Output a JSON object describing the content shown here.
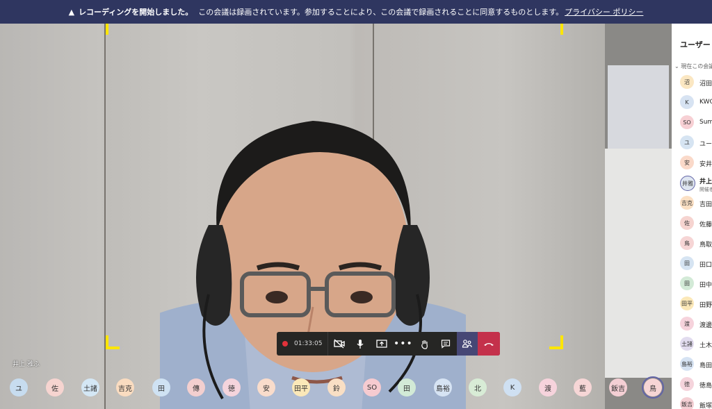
{
  "banner": {
    "warning_icon": "▲",
    "recording_started": "レコーディングを開始しました。",
    "message": "この会議は録画されています。参加することにより、この会議で録画されることに同意するものとします。",
    "privacy_link": "プライバシー ポリシー"
  },
  "video": {
    "user_label": "井上 雅ふ"
  },
  "controls": {
    "recording_time": "01:33:05",
    "icons": [
      "camera-off-icon",
      "microphone-icon",
      "share-screen-icon",
      "more-options-icon",
      "raise-hand-icon",
      "chat-icon",
      "participants-icon",
      "hang-up-icon"
    ]
  },
  "avatar_row": [
    {
      "initials": "ユ",
      "color": "#c7dcef"
    },
    {
      "initials": "佐",
      "color": "#f6d4d0"
    },
    {
      "initials": "土諸",
      "color": "#d4e7f5"
    },
    {
      "initials": "吉克",
      "color": "#fadcc0"
    },
    {
      "initials": "田",
      "color": "#cfe2f3"
    },
    {
      "initials": "傳",
      "color": "#f3cfcf"
    },
    {
      "initials": "徳",
      "color": "#f5d4dc"
    },
    {
      "initials": "安",
      "color": "#f9dccb"
    },
    {
      "initials": "田平",
      "color": "#fbe8b8"
    },
    {
      "initials": "鈴",
      "color": "#f9dfc4"
    },
    {
      "initials": "SO",
      "color": "#f6cbd0"
    },
    {
      "initials": "田",
      "color": "#d2ead6"
    },
    {
      "initials": "島裕",
      "color": "#d6e3f3"
    },
    {
      "initials": "北",
      "color": "#d8ecd6"
    },
    {
      "initials": "K",
      "color": "#cfe0f2"
    },
    {
      "initials": "渡",
      "color": "#f6d3dc"
    },
    {
      "initials": "藍",
      "color": "#f6d6d6"
    },
    {
      "initials": "飯吉",
      "color": "#f4cfd4"
    },
    {
      "initials": "鳥",
      "color": "#f6d5d5"
    }
  ],
  "sidebar": {
    "title": "ユーザー",
    "section": "現在この会議",
    "items": [
      {
        "initials": "沼",
        "name": "沼田",
        "color": "#fbe7c2"
      },
      {
        "initials": "K",
        "name": "KWC",
        "color": "#d7e3f2"
      },
      {
        "initials": "SO",
        "name": "Sumi",
        "color": "#f7d0d4"
      },
      {
        "initials": "ユ",
        "name": "ユー",
        "color": "#d6e4f2"
      },
      {
        "initials": "安",
        "name": "安井",
        "color": "#fad9c9"
      },
      {
        "initials": "井雅",
        "name": "井上",
        "sub": "開催者",
        "color": "#dfe6f1",
        "bold": true
      },
      {
        "initials": "吉克",
        "name": "吉田",
        "color": "#fbe0c4"
      },
      {
        "initials": "佐",
        "name": "佐藤",
        "color": "#f6d4d0"
      },
      {
        "initials": "鳥",
        "name": "鳥取",
        "color": "#f6d5d5"
      },
      {
        "initials": "田",
        "name": "田口",
        "color": "#d6e4f2"
      },
      {
        "initials": "田",
        "name": "田中",
        "color": "#d3ead7"
      },
      {
        "initials": "田平",
        "name": "田野",
        "color": "#fbe8b8"
      },
      {
        "initials": "渡",
        "name": "渡邊",
        "color": "#f6d3dc"
      },
      {
        "initials": "土諸",
        "name": "土木",
        "color": "#e2dcef"
      },
      {
        "initials": "島裕",
        "name": "島田",
        "color": "#d6e3f3"
      },
      {
        "initials": "徳",
        "name": "徳島",
        "color": "#f5d4dc"
      },
      {
        "initials": "飯吉",
        "name": "飯塚",
        "color": "#f4cfd4"
      }
    ]
  }
}
